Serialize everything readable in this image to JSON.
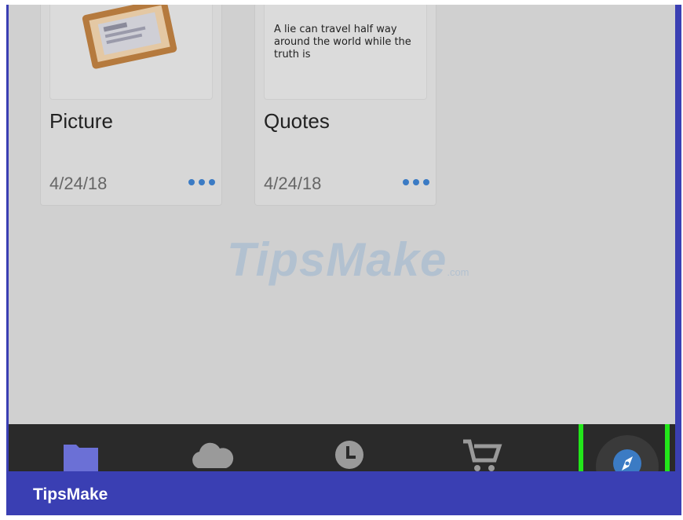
{
  "files": [
    {
      "title": "Picture",
      "date": "4/24/18"
    },
    {
      "title": "Quotes",
      "date": "4/24/18",
      "preview_text": "A lie can travel half way around the world while the truth is"
    }
  ],
  "watermark": {
    "text": "TipsMake",
    "suffix": ".com"
  },
  "tabbar": {
    "tabs": [
      "folder-icon",
      "cloud-icon",
      "clock-icon",
      "cart-icon",
      "compass-icon"
    ],
    "highlight_color": "#22e61a",
    "accent": "#3b7bc4"
  },
  "footer": {
    "label": "TipsMake",
    "color": "#3a3fb3"
  }
}
